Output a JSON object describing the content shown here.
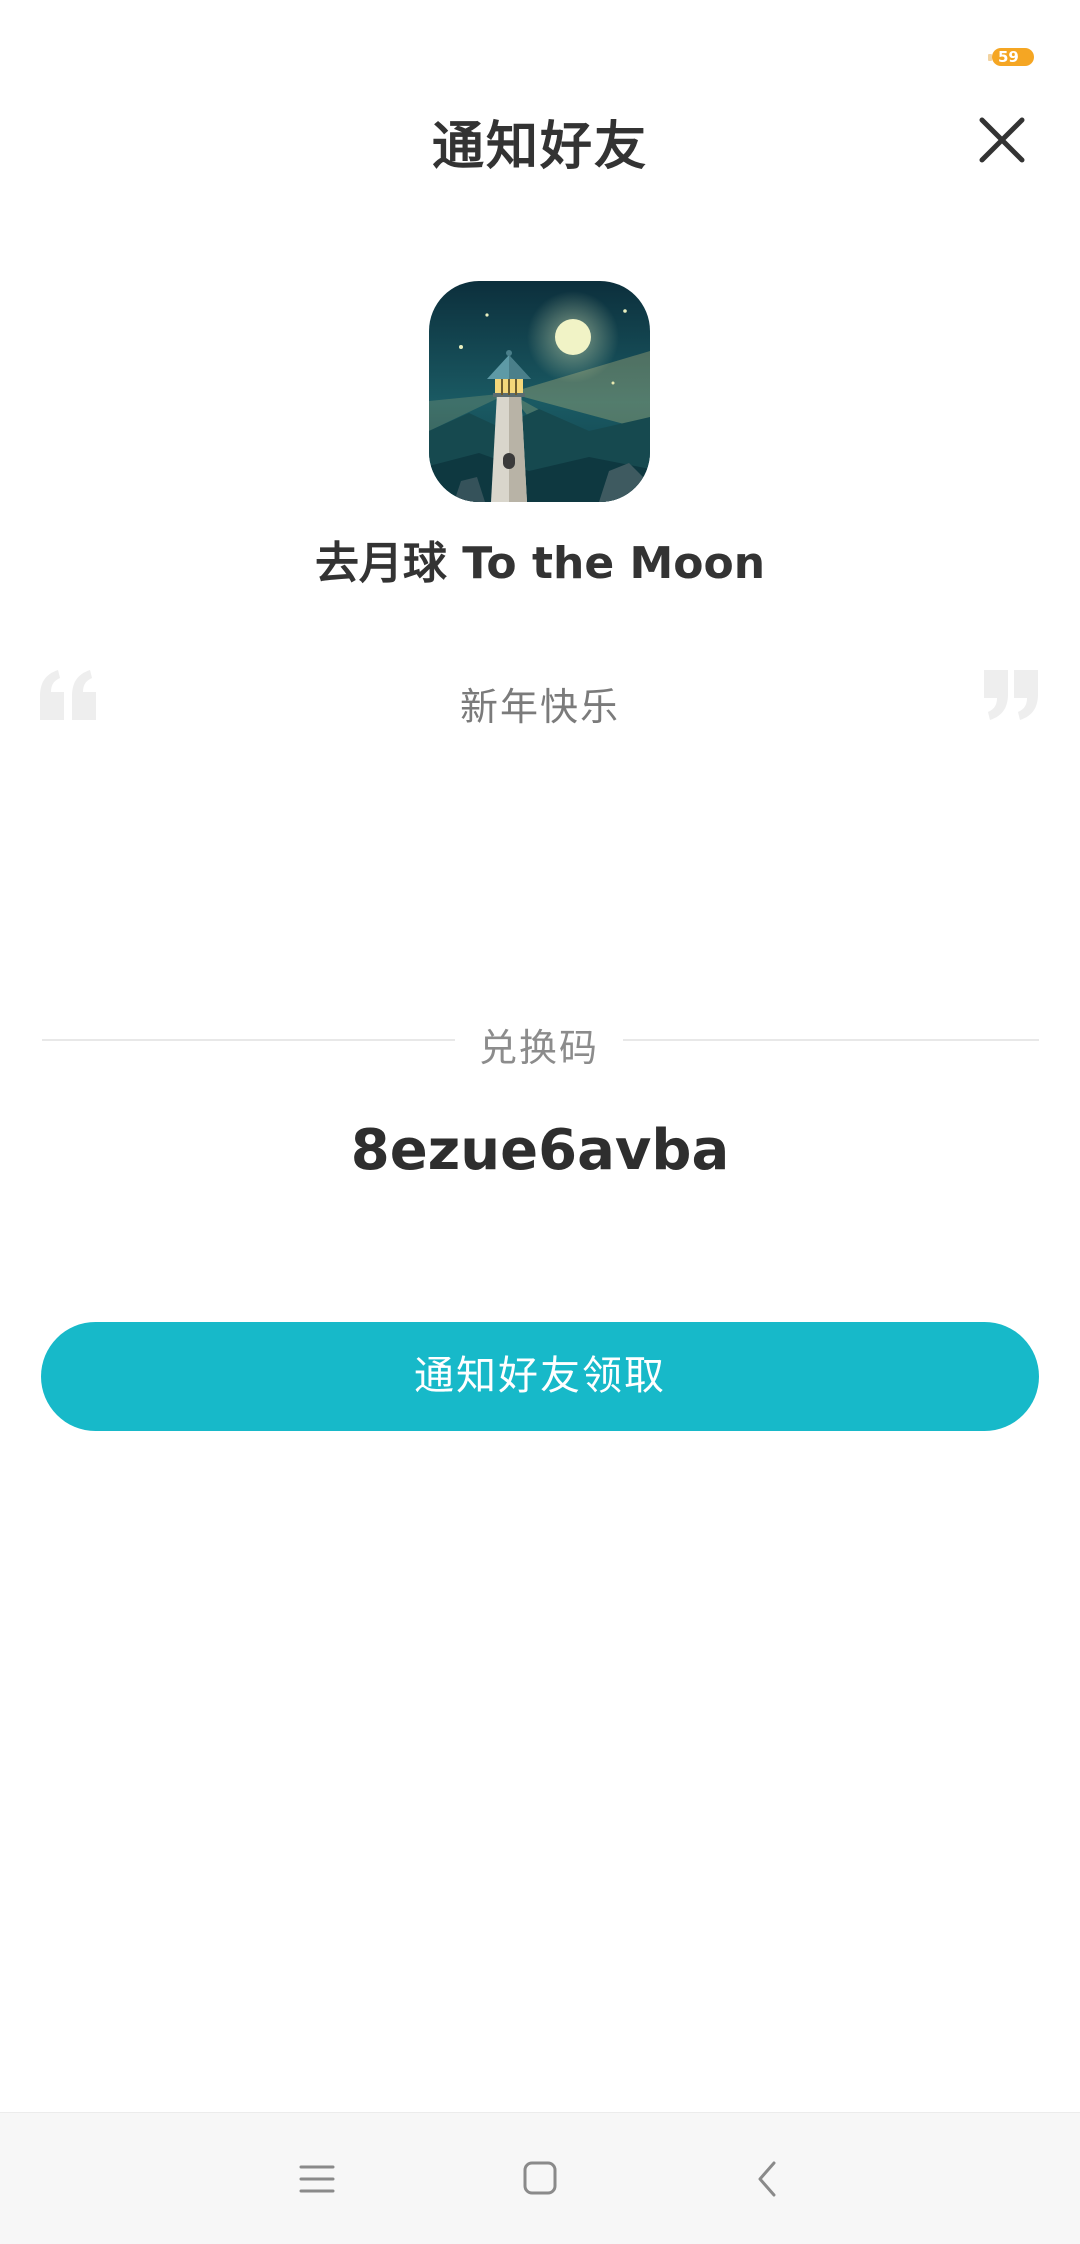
{
  "status_bar": {
    "battery_level": "59"
  },
  "header": {
    "title": "通知好友",
    "close_icon": "close-icon"
  },
  "app": {
    "name": "去月球 To the Moon",
    "icon": "lighthouse-app-icon"
  },
  "message": {
    "text": "新年快乐",
    "quote_open_icon": "quote-open-icon",
    "quote_close_icon": "quote-close-icon"
  },
  "code": {
    "label": "兑换码",
    "value": "8ezue6avba"
  },
  "action": {
    "button_label": "通知好友领取"
  },
  "colors": {
    "accent": "#17b9c9",
    "title_text": "#333333",
    "secondary_text": "#8c8c8c",
    "battery": "#f5a623"
  },
  "navigation_bar": {
    "menu_icon": "menu-icon",
    "home_icon": "home-icon",
    "back_icon": "back-icon"
  }
}
